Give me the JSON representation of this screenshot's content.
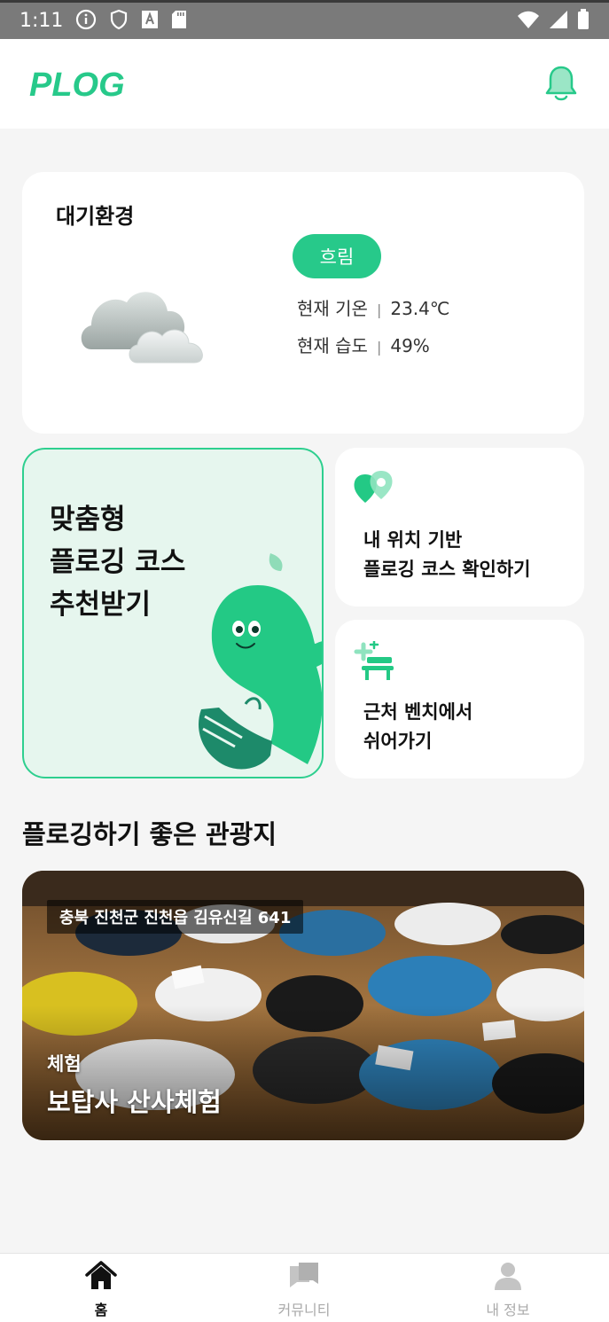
{
  "status_bar": {
    "time": "1:11"
  },
  "header": {
    "logo_text": "PLOG"
  },
  "weather": {
    "title": "대기환경",
    "condition": "흐림",
    "temp_label": "현재 기온",
    "temp_value": "23.4℃",
    "humidity_label": "현재 습도",
    "humidity_value": "49%"
  },
  "reco_card": {
    "line1": "맞춤형",
    "line2": "플로깅 코스",
    "line3": "추천받기"
  },
  "nearby_card": {
    "line1": "내 위치 기반",
    "line2": "플로깅 코스 확인하기"
  },
  "bench_card": {
    "line1": "근처 벤치에서",
    "line2": "쉬어가기"
  },
  "section": {
    "title": "플로깅하기 좋은 관광지"
  },
  "tour": {
    "address": "충북 진천군 진천읍 김유신길 641",
    "category": "체험",
    "name": "보탑사 산사체험"
  },
  "nav": {
    "home": "홈",
    "community": "커뮤니티",
    "profile": "내 정보"
  },
  "colors": {
    "accent": "#27c98a",
    "accent_light": "#e6f6ee"
  }
}
